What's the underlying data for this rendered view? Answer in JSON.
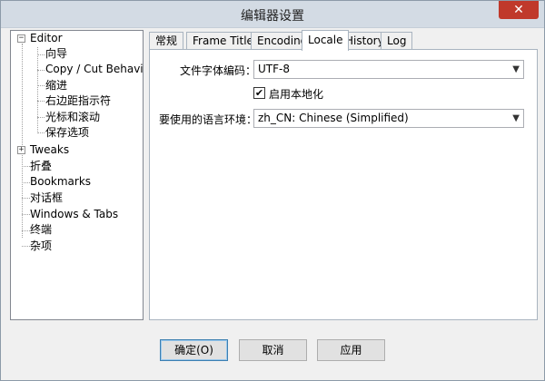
{
  "window": {
    "title": "编辑器设置",
    "close_glyph": "✕"
  },
  "tree": {
    "editor": "Editor",
    "editor_children": [
      "向导",
      "Copy / Cut Behavior",
      "缩进",
      "右边距指示符",
      "光标和滚动",
      "保存选项"
    ],
    "others": [
      "Tweaks",
      "折叠",
      "Bookmarks",
      "对话框",
      "Windows & Tabs",
      "终端",
      "杂项"
    ],
    "expander_minus": "−",
    "expander_plus": "+"
  },
  "tabs": [
    "常规",
    "Frame Title",
    "Encoding",
    "Locale",
    "History",
    "Log"
  ],
  "active_tab": "Locale",
  "locale_panel": {
    "encoding_label": "文件字体编码：",
    "encoding_value": "UTF-8",
    "localize_label": "启用本地化",
    "localize_checked": true,
    "check_glyph": "✔",
    "language_label": "要使用的语言环境：",
    "language_value": "zh_CN: Chinese (Simplified)",
    "dropdown_arrow": "▼"
  },
  "buttons": {
    "ok": "确定(O)",
    "cancel": "取消",
    "apply": "应用"
  }
}
